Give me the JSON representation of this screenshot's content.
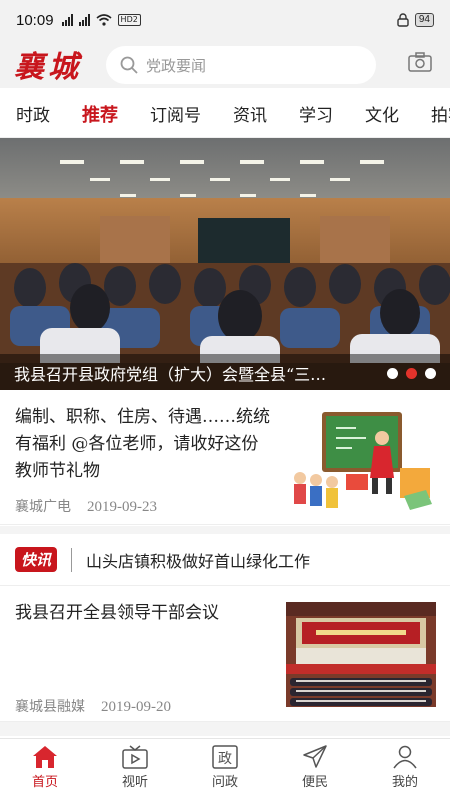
{
  "status_bar": {
    "time": "10:09",
    "network_badge": "HD2",
    "battery": "94"
  },
  "header": {
    "logo": "襄城",
    "search_placeholder": "党政要闻"
  },
  "tabs": [
    {
      "label": "时政",
      "active": false
    },
    {
      "label": "推荐",
      "active": true
    },
    {
      "label": "订阅号",
      "active": false
    },
    {
      "label": "资讯",
      "active": false
    },
    {
      "label": "学习",
      "active": false
    },
    {
      "label": "文化",
      "active": false
    },
    {
      "label": "拍客",
      "active": false
    }
  ],
  "banner": {
    "caption": "我县召开县政府党组（扩大）会暨全县“三…",
    "slides": 3,
    "active_slide": 2
  },
  "news": [
    {
      "title": "编制、职称、住房、待遇……统统有福利 @各位老师，请收好这份教师节礼物",
      "source": "襄城广电",
      "date": "2019-09-23"
    },
    {
      "title": "我县召开全县领导干部会议",
      "source": "襄城县融媒",
      "date": "2019-09-20"
    }
  ],
  "flash": {
    "badge": "快讯",
    "text": "山头店镇积极做好首山绿化工作"
  },
  "bottom_nav": [
    {
      "label": "首页",
      "icon": "home-icon",
      "active": true
    },
    {
      "label": "视听",
      "icon": "tv-icon",
      "active": false
    },
    {
      "label": "问政",
      "icon": "politics-icon",
      "active": false
    },
    {
      "label": "便民",
      "icon": "send-icon",
      "active": false
    },
    {
      "label": "我的",
      "icon": "user-icon",
      "active": false
    }
  ],
  "colors": {
    "brand_red": "#c8161d",
    "slide_active": "#e3332b"
  }
}
